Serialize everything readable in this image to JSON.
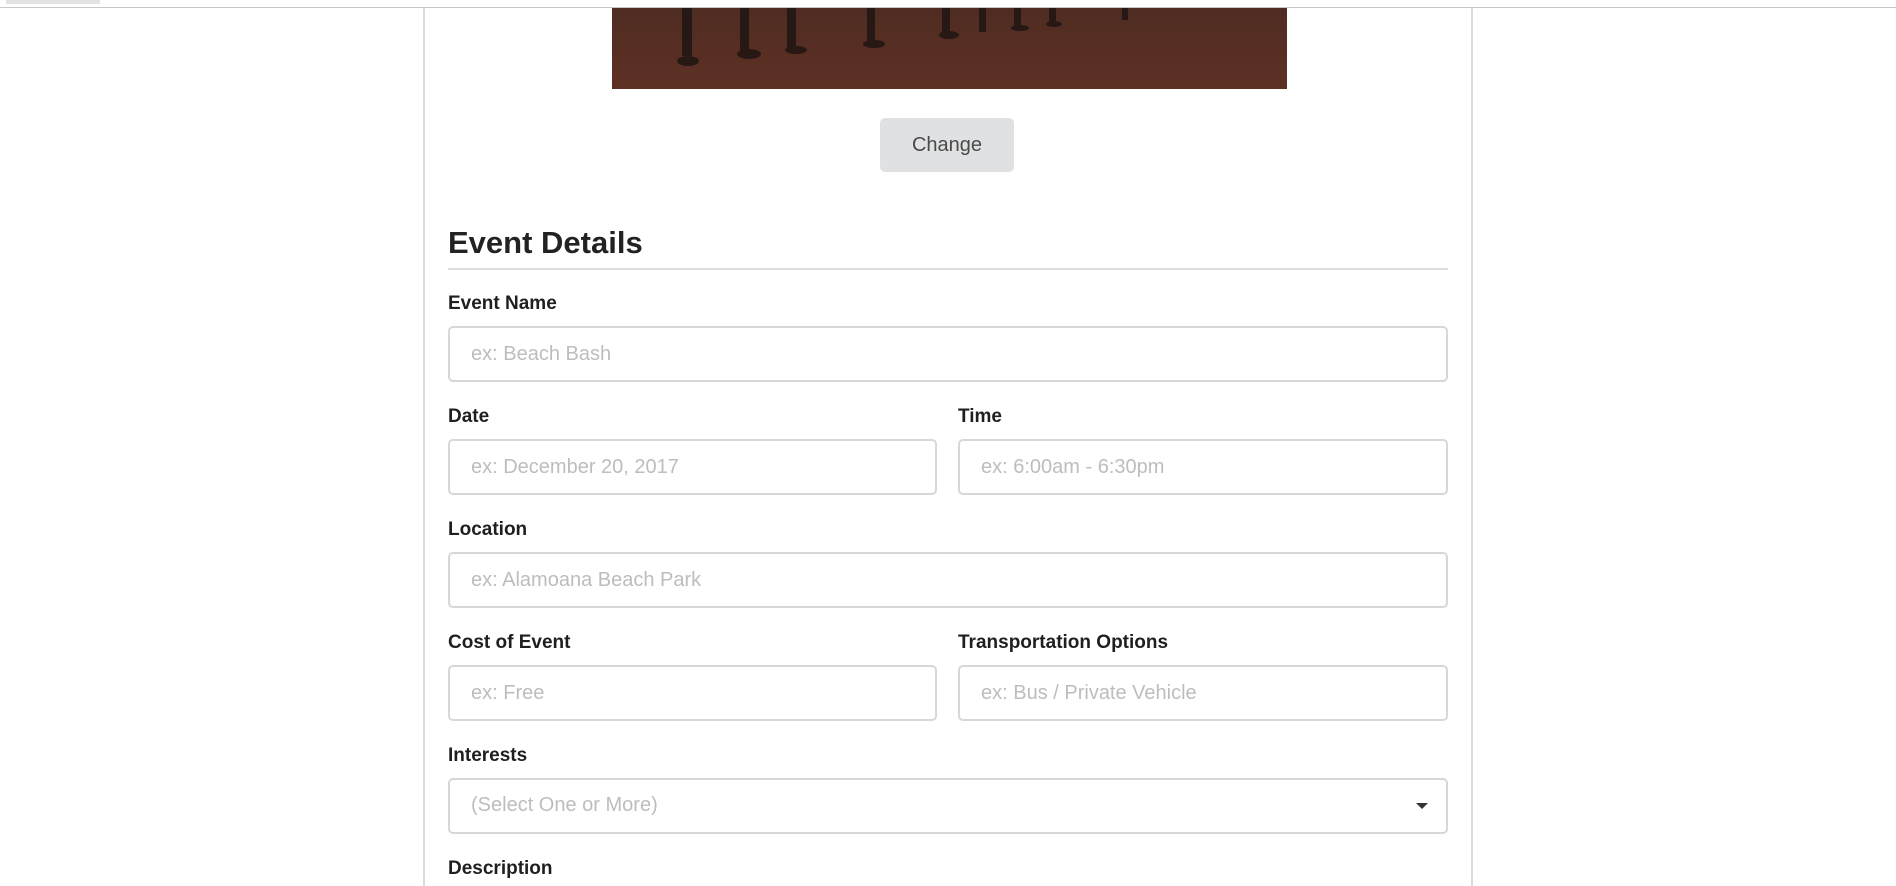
{
  "form": {
    "change_button": "Change",
    "section_title": "Event Details",
    "fields": {
      "event_name": {
        "label": "Event Name",
        "placeholder": "ex: Beach Bash"
      },
      "date": {
        "label": "Date",
        "placeholder": "ex: December 20, 2017"
      },
      "time": {
        "label": "Time",
        "placeholder": "ex: 6:00am - 6:30pm"
      },
      "location": {
        "label": "Location",
        "placeholder": "ex: Alamoana Beach Park"
      },
      "cost": {
        "label": "Cost of Event",
        "placeholder": "ex: Free"
      },
      "transportation": {
        "label": "Transportation Options",
        "placeholder": "ex: Bus / Private Vehicle"
      },
      "interests": {
        "label": "Interests",
        "placeholder": "(Select One or More)"
      },
      "description": {
        "label": "Description"
      }
    }
  },
  "icons": {
    "interests_caret": "chevron-down-icon"
  },
  "colors": {
    "hero_top": "#3a2620",
    "hero_mid": "#5b3326",
    "button_bg": "#e0e1e2",
    "label_text": "#1f1f1f",
    "placeholder_text": "#bdbdbd",
    "border": "#d7d7d7"
  }
}
